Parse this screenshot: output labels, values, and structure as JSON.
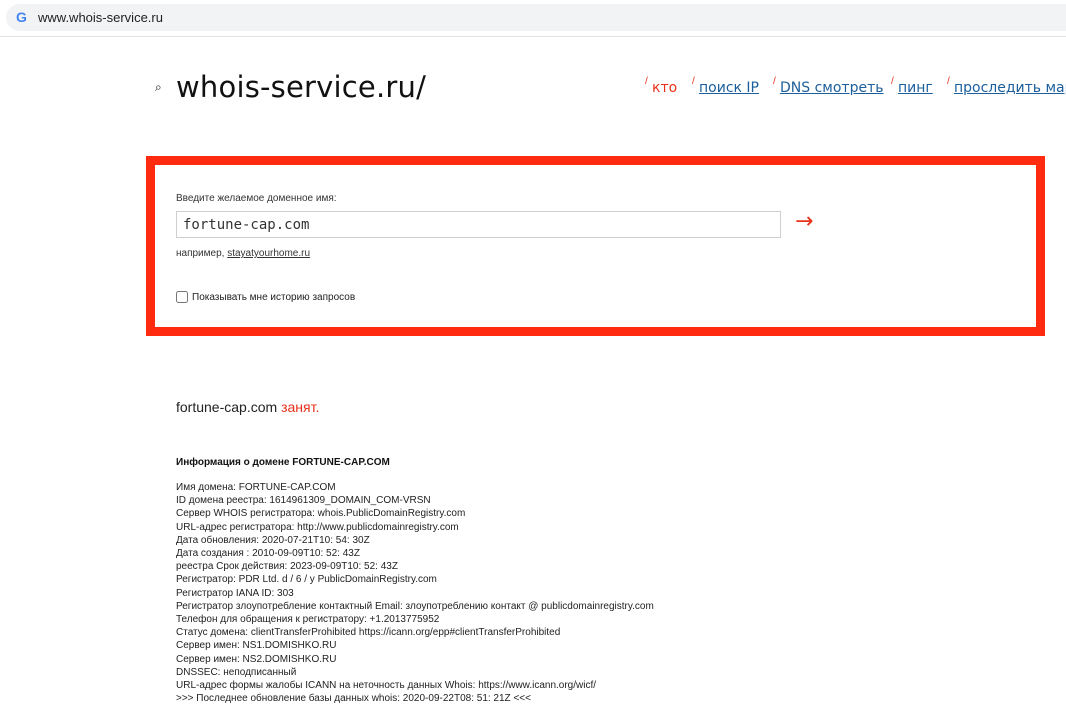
{
  "browser": {
    "url": "www.whois-service.ru",
    "favicon": "G"
  },
  "header": {
    "logo_icon": "magnifier-icon",
    "logo": "whois-service.ru/",
    "nav": [
      {
        "label": "кто",
        "active": true
      },
      {
        "label": "поиск IP",
        "active": false
      },
      {
        "label": "DNS смотреть",
        "active": false
      },
      {
        "label": "пинг",
        "active": false
      },
      {
        "label": "проследить мар",
        "active": false
      }
    ]
  },
  "search": {
    "label": "Введите желаемое доменное имя:",
    "value": "fortune-cap.com",
    "submit": "→",
    "example_prefix": "например,",
    "example_link": "stayatyourhome.ru",
    "history_label": "Показывать мне историю запросов",
    "history_checked": false
  },
  "result": {
    "domain": "fortune-cap.com",
    "status": "занят."
  },
  "info": {
    "title": "Информация о домене FORTUNE-CAP.COM",
    "lines": [
      "Имя домена: FORTUNE-CAP.COM",
      "ID домена реестра: 1614961309_DOMAIN_COM-VRSN",
      "Сервер WHOIS регистратора: whois.PublicDomainRegistry.com",
      "URL-адрес регистратора: http://www.publicdomainregistry.com",
      "Дата обновления: 2020-07-21T10: 54: 30Z",
      "Дата создания : 2010-09-09T10: 52: 43Z",
      "реестра Срок действия: 2023-09-09T10: 52: 43Z",
      "Регистратор: PDR Ltd. d / 6 / y PublicDomainRegistry.com",
      "Регистратор IANA ID: 303",
      "Регистратор злоупотребление контактный Email: злоупотреблению контакт @ publicdomainregistry.com",
      "Телефон для обращения к регистратору: +1.2013775952",
      "Статус домена: clientTransferProhibited https://icann.org/epp#clientTransferProhibited",
      "Сервер имен: NS1.DOMISHKO.RU",
      "Сервер имен: NS2.DOMISHKO.RU",
      "DNSSEC: неподписанный",
      "URL-адрес формы жалобы ICANN на неточность данных Whois: https://www.icann.org/wicf/",
      ">>> Последнее обновление базы данных whois: 2020-09-22T08: 51: 21Z <<<"
    ]
  },
  "colors": {
    "accent": "#e8311a",
    "box_border": "#ff2a0f",
    "link": "#1b5e9b"
  }
}
